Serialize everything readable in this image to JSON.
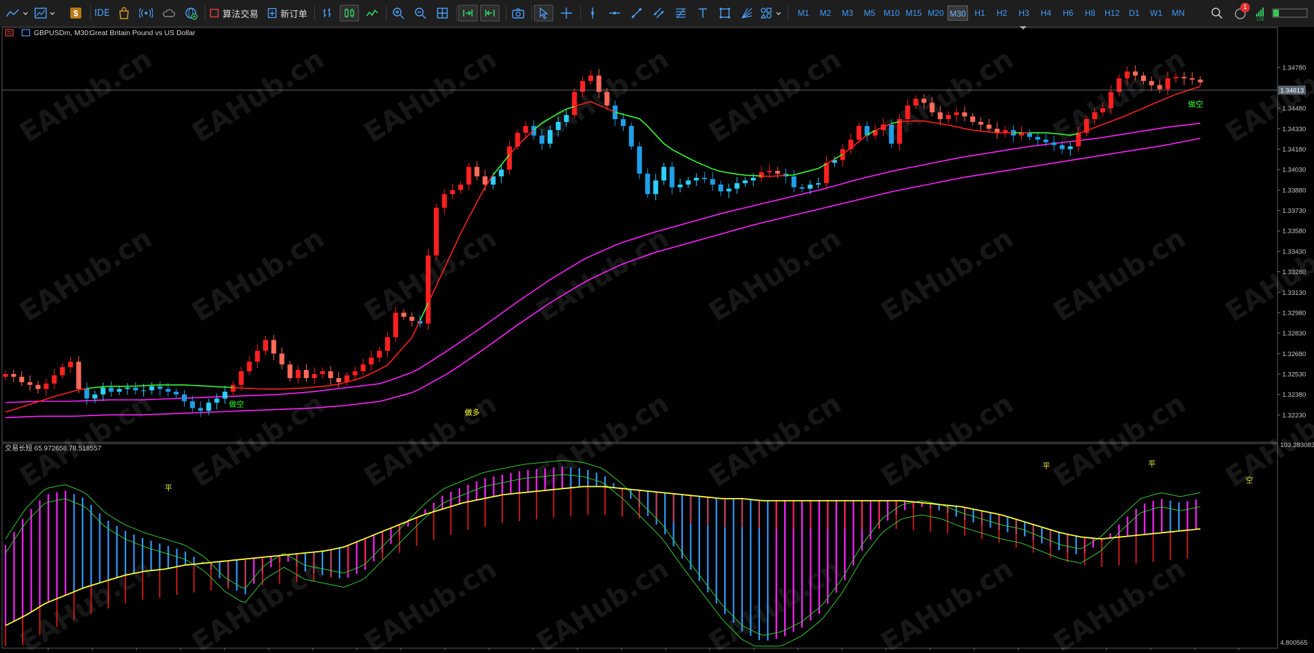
{
  "toolbar": {
    "ide_label": "IDE",
    "algo_trading_label": "算法交易",
    "new_order_label": "新订单",
    "notification_count": "1",
    "timeframes": [
      "M1",
      "M2",
      "M3",
      "M5",
      "M10",
      "M15",
      "M20",
      "M30",
      "H1",
      "H2",
      "H3",
      "H4",
      "H6",
      "H8",
      "H12",
      "D1",
      "W1",
      "MN"
    ],
    "active_timeframe": "M30"
  },
  "chart_title": {
    "symbol_tf": "GBPUSDm, M30:",
    "description": "Great Britain Pound vs US Dollar"
  },
  "indicator_title": "交易长短 65.972658 78.518557",
  "watermark": "EAHub.cn",
  "colors": {
    "bull_candle": "#ff2020",
    "bear_candle": "#00e5ff",
    "upper_ma": "#ff2020",
    "mid_ma_green": "#33ff33",
    "envelope": "#ff22ff",
    "osc_up": "#ff22ff",
    "osc_down": "#3399ff",
    "osc_signal": "#ffff33",
    "osc_hist_red": "#ff2020",
    "osc_envelope": "#33cc33",
    "current_price_box": "#5a6370"
  },
  "chart_data": [
    {
      "type": "candlestick",
      "title": "GBPUSDm, M30: Great Britain Pound vs US Dollar",
      "y_ticks": [
        "1.34780",
        "1.34630",
        "1.34480",
        "1.34330",
        "1.34180",
        "1.34030",
        "1.33880",
        "1.33730",
        "1.33580",
        "1.33430",
        "1.33280",
        "1.33130",
        "1.32980",
        "1.32830",
        "1.32680",
        "1.32530",
        "1.32380",
        "1.32230"
      ],
      "ylim": [
        1.3209,
        1.3486
      ],
      "current_price": "1.34613",
      "closes": [
        1.3253,
        1.3251,
        1.3247,
        1.3245,
        1.3242,
        1.3246,
        1.3252,
        1.3258,
        1.3262,
        1.3242,
        1.3235,
        1.3238,
        1.3243,
        1.324,
        1.3242,
        1.3243,
        1.3241,
        1.3241,
        1.3244,
        1.3242,
        1.324,
        1.3238,
        1.3233,
        1.3228,
        1.3226,
        1.3232,
        1.3235,
        1.324,
        1.3245,
        1.3255,
        1.3262,
        1.327,
        1.3278,
        1.3268,
        1.326,
        1.325,
        1.3256,
        1.325,
        1.3253,
        1.3255,
        1.325,
        1.3247,
        1.3252,
        1.3255,
        1.326,
        1.3265,
        1.327,
        1.328,
        1.3298,
        1.3295,
        1.3292,
        1.329,
        1.334,
        1.3375,
        1.3385,
        1.3388,
        1.3392,
        1.3405,
        1.3398,
        1.3392,
        1.3398,
        1.3403,
        1.342,
        1.343,
        1.3435,
        1.3428,
        1.3422,
        1.3432,
        1.3438,
        1.3443,
        1.346,
        1.3468,
        1.3472,
        1.346,
        1.345,
        1.344,
        1.3435,
        1.342,
        1.34,
        1.3385,
        1.3395,
        1.3405,
        1.339,
        1.3392,
        1.3395,
        1.3397,
        1.3396,
        1.3392,
        1.3387,
        1.3389,
        1.3393,
        1.3395,
        1.3397,
        1.3401,
        1.3402,
        1.34,
        1.3398,
        1.339,
        1.3389,
        1.3392,
        1.3393,
        1.3408,
        1.341,
        1.3418,
        1.3425,
        1.3435,
        1.3428,
        1.3432,
        1.3436,
        1.3422,
        1.344,
        1.345,
        1.3455,
        1.3452,
        1.3445,
        1.344,
        1.3443,
        1.3445,
        1.3442,
        1.3438,
        1.3436,
        1.3433,
        1.343,
        1.3432,
        1.3428,
        1.343,
        1.3427,
        1.3425,
        1.3423,
        1.3421,
        1.3418,
        1.342,
        1.343,
        1.344,
        1.3445,
        1.3448,
        1.346,
        1.347,
        1.3475,
        1.3472,
        1.3468,
        1.3465,
        1.3462,
        1.347,
        1.3471,
        1.347,
        1.3469,
        1.3467
      ],
      "series": [
        {
          "name": "upper_ma",
          "values": [
            1.3225,
            1.3231,
            1.3237,
            1.3242,
            1.3244,
            1.3244,
            1.3245,
            1.3245,
            1.3244,
            1.3243,
            1.3242,
            1.3242,
            1.3243,
            1.3245,
            1.325,
            1.3259,
            1.328,
            1.332,
            1.336,
            1.3395,
            1.3418,
            1.3436,
            1.3447,
            1.3453,
            1.3445,
            1.344,
            1.342,
            1.341,
            1.3402,
            1.3399,
            1.3398,
            1.3399,
            1.3404,
            1.3415,
            1.343,
            1.3438,
            1.3439,
            1.3436,
            1.3432,
            1.343,
            1.343,
            1.343,
            1.3428,
            1.3435,
            1.3442,
            1.345,
            1.3458,
            1.3464
          ]
        },
        {
          "name": "envelope_upper",
          "values": [
            1.3232,
            1.3233,
            1.3233,
            1.3234,
            1.3234,
            1.3235,
            1.3236,
            1.3237,
            1.3238,
            1.324,
            1.3243,
            1.3246,
            1.3255,
            1.3271,
            1.3288,
            1.3306,
            1.3323,
            1.3338,
            1.3349,
            1.3357,
            1.3364,
            1.3371,
            1.3377,
            1.3383,
            1.3389,
            1.3396,
            1.3402,
            1.3407,
            1.3412,
            1.3416,
            1.342,
            1.3423,
            1.3426,
            1.343,
            1.3434,
            1.3437
          ]
        },
        {
          "name": "envelope_lower",
          "values": [
            1.3221,
            1.3222,
            1.3222,
            1.3223,
            1.3223,
            1.3224,
            1.3225,
            1.3226,
            1.3227,
            1.3228,
            1.323,
            1.3233,
            1.324,
            1.3254,
            1.3271,
            1.3289,
            1.3306,
            1.3321,
            1.3333,
            1.3342,
            1.3349,
            1.3356,
            1.3363,
            1.3369,
            1.3375,
            1.3381,
            1.3387,
            1.3392,
            1.3397,
            1.3401,
            1.3405,
            1.3409,
            1.3413,
            1.3417,
            1.3421,
            1.3426
          ]
        }
      ],
      "annotations": [
        {
          "text": "做空",
          "bar": 28,
          "price": 1.3229,
          "color": "#33ff33"
        },
        {
          "text": "做多",
          "bar": 57,
          "price": 1.3223,
          "color": "#ffff33"
        },
        {
          "text": "做空",
          "bar": 146,
          "price": 1.3449,
          "color": "#33ff33"
        },
        {
          "text": "做多",
          "bar": 194,
          "price": 1.3392,
          "color": "#ffff33"
        },
        {
          "text": "做空",
          "bar": 238,
          "price": 1.3431,
          "color": "#33ff33"
        },
        {
          "text": "做多",
          "bar": 260,
          "price": 1.3422,
          "color": "#ffff33"
        }
      ]
    },
    {
      "type": "line",
      "title": "交易长短 65.972658 78.518557",
      "y_ticks": [
        "103.283083",
        "4.800565"
      ],
      "ylim": [
        4.800565,
        103.283083
      ],
      "series": [
        {
          "name": "fast",
          "values": [
            55,
            70,
            80,
            82,
            78,
            68,
            62,
            58,
            55,
            52,
            46,
            36,
            30,
            42,
            48,
            42,
            40,
            38,
            42,
            52,
            62,
            72,
            80,
            84,
            88,
            90,
            92,
            93,
            94,
            93,
            90,
            82,
            72,
            62,
            48,
            35,
            22,
            12,
            7,
            9,
            14,
            22,
            35,
            52,
            65,
            72,
            74,
            72,
            68,
            65,
            62,
            60,
            56,
            52,
            50,
            56,
            66,
            75,
            78,
            76,
            78
          ]
        },
        {
          "name": "slow",
          "values": [
            15,
            20,
            26,
            30,
            34,
            37,
            40,
            42,
            43,
            45,
            46,
            47,
            48,
            49,
            50,
            51,
            52,
            54,
            58,
            62,
            66,
            70,
            73,
            76,
            78,
            80,
            81,
            82,
            83,
            84,
            84,
            83,
            82,
            81,
            80,
            79,
            78,
            78,
            77,
            77,
            77,
            77,
            77,
            77,
            77,
            77,
            76,
            75,
            74,
            72,
            70,
            67,
            64,
            61,
            59,
            58,
            59,
            60,
            61,
            62,
            63
          ]
        }
      ],
      "annotations": [
        {
          "text": "平",
          "bar": 20,
          "value": 82
        },
        {
          "text": "平",
          "bar": 128,
          "value": 93
        },
        {
          "text": "平",
          "bar": 141,
          "value": 94
        },
        {
          "text": "空",
          "bar": 153,
          "value": 86
        },
        {
          "text": "平",
          "bar": 196,
          "value": 10
        },
        {
          "text": "空",
          "bar": 232,
          "value": 81
        }
      ]
    }
  ]
}
